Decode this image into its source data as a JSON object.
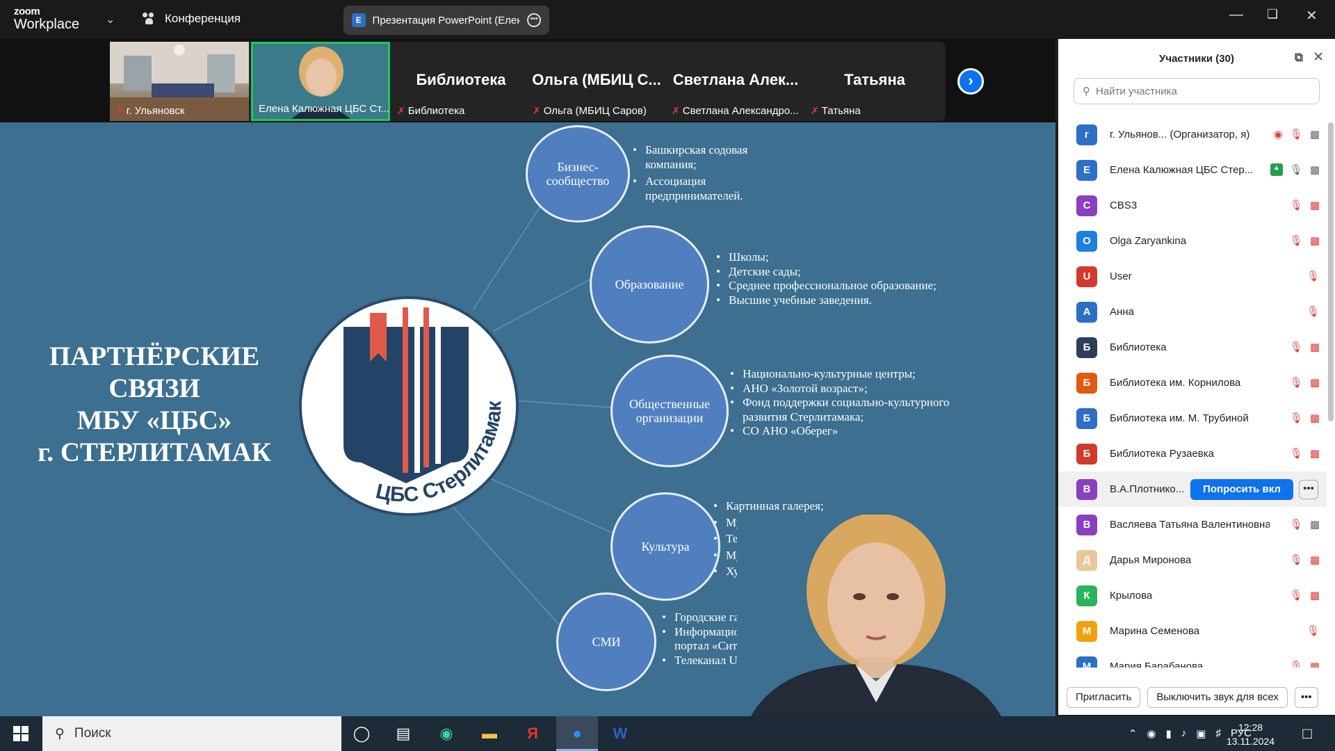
{
  "app": {
    "brand_top": "zoom",
    "brand_bottom": "Workplace",
    "conference_label": "Конференция",
    "share_title": "Презентация PowerPoint (Елена",
    "share_icon_letter": "E"
  },
  "strip": {
    "tiles": [
      {
        "name": "г. Ульяновск",
        "muted": true
      },
      {
        "name": "Елена Калюжная ЦБС Ст...",
        "muted": false
      },
      {
        "name": "Библиотека",
        "big": "Библиотека",
        "muted": true
      },
      {
        "name": "Ольга (МБИЦ Саров)",
        "big": "Ольга (МБИЦ С...",
        "muted": true
      },
      {
        "name": "Светлана Александро...",
        "big": "Светлана Алек...",
        "muted": true
      },
      {
        "name": "Татьяна",
        "big": "Татьяна",
        "muted": true
      }
    ]
  },
  "slide": {
    "title_lines": [
      "ПАРТНЁРСКИЕ",
      "СВЯЗИ",
      "МБУ «ЦБС»",
      "г. СТЕРЛИТАМАК"
    ],
    "logo_text": "ЦБС Стерлитамак",
    "nodes": [
      {
        "label": "Бизнес-сообщество",
        "items": [
          "Башкирская содовая компания;",
          "Ассоциация предпринимателей."
        ]
      },
      {
        "label": "Образование",
        "items": [
          "Школы;",
          "Детские сады;",
          "Среднее профессиональное образование;",
          "Высшие учебные заведения."
        ]
      },
      {
        "label": "Общественные организации",
        "items": [
          "Национально-культурные центры;",
          "АНО «Золотой возраст»;",
          "Фонд поддержки социально-культурного развития Стерлитамака;",
          "СО АНО «Оберег»"
        ]
      },
      {
        "label": "Культура",
        "items": [
          "Картинная галерея;",
          "Музей;",
          "Театр",
          "Музыкальные",
          "Художествен"
        ]
      },
      {
        "label": "СМИ",
        "items": [
          "Городские газеты;",
          "Информационный портал «Сити-опен»;",
          "Телеканал UTV"
        ]
      }
    ]
  },
  "panel": {
    "title": "Участники (30)",
    "search_placeholder": "Найти участника",
    "ask_button": "Попросить вкл",
    "invite_button": "Пригласить",
    "mute_all_button": "Выключить звук для всех",
    "participants": [
      {
        "initial": "г",
        "name": "г. Ульянов...  (Организатор, я)",
        "color": "#2d6fc7",
        "icons": [
          "rec",
          "mic-off",
          "cam"
        ]
      },
      {
        "initial": "Е",
        "name": "Елена Калюжная ЦБС Стер...",
        "color": "#2d6fc7",
        "icons": [
          "share",
          "mic",
          "cam"
        ]
      },
      {
        "initial": "C",
        "name": "CBS3",
        "color": "#8a3fc0",
        "icons": [
          "mic-off",
          "cam-off"
        ]
      },
      {
        "initial": "O",
        "name": "Olga Zaryankina",
        "color": "#1e7fe0",
        "icons": [
          "mic-off",
          "cam-off"
        ]
      },
      {
        "initial": "U",
        "name": "User",
        "color": "#d23a2a",
        "icons": [
          "mic-off"
        ]
      },
      {
        "initial": "А",
        "name": "Анна",
        "color": "#2d6fc7",
        "icons": [
          "mic-off"
        ]
      },
      {
        "initial": "Б",
        "name": "Библиотека",
        "color": "#2e3e5a",
        "icons": [
          "mic-off",
          "cam-off"
        ]
      },
      {
        "initial": "Б",
        "name": "Библиотека им. Корнилова",
        "color": "#e05a10",
        "icons": [
          "mic-off",
          "cam-off"
        ]
      },
      {
        "initial": "Б",
        "name": "Библиотека им. М. Трубиной",
        "color": "#2d6fc7",
        "icons": [
          "mic-off",
          "cam-off"
        ]
      },
      {
        "initial": "Б",
        "name": "Библиотека Рузаевка",
        "color": "#d23a2a",
        "icons": [
          "mic-off",
          "cam-off"
        ]
      },
      {
        "initial": "В",
        "name": "В.А.Плотнико...",
        "color": "#8a3fc0",
        "icons": [],
        "highlight": true
      },
      {
        "initial": "В",
        "name": "Васляева Татьяна Валентиновна",
        "color": "#8a3fc0",
        "icons": [
          "mic-off",
          "cam"
        ]
      },
      {
        "initial": "Д",
        "name": "Дарья Миронова",
        "color": "#e8c89a",
        "icons": [
          "mic-off",
          "cam-off"
        ]
      },
      {
        "initial": "К",
        "name": "Крылова",
        "color": "#2bb35a",
        "icons": [
          "mic-off",
          "cam-off"
        ]
      },
      {
        "initial": "М",
        "name": "Марина Семенова",
        "color": "#f0a010",
        "icons": [
          "mic-off"
        ]
      },
      {
        "initial": "М",
        "name": "Мария Барабанова",
        "color": "#2d6fc7",
        "icons": [
          "mic-off",
          "cam-off"
        ]
      }
    ]
  },
  "taskbar": {
    "search_label": "Поиск",
    "lang": "РУС",
    "time": "12:28",
    "date": "13.11.2024"
  }
}
